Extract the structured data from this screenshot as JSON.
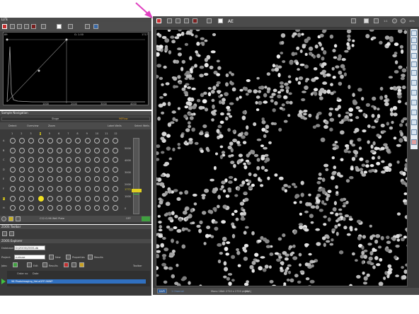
{
  "histogram": {
    "title": "LUTs",
    "max_label": "1717",
    "gamma_label": "G: 1.00",
    "min_label": "89",
    "ticks": [
      "1000",
      "2000",
      "3000",
      "4000"
    ]
  },
  "navigation": {
    "title": "Sample Navigation",
    "stage_label": "Stage",
    "grid_label": "96Flow",
    "tabs": [
      "Detect",
      "Overview",
      "Zoom"
    ],
    "label_wells": "Label Wells",
    "select_wells": "Select Wells",
    "columns": [
      "1",
      "2",
      "3",
      "4",
      "5",
      "6",
      "7",
      "8",
      "9",
      "10",
      "11",
      "12"
    ],
    "rows": [
      "A",
      "B",
      "C",
      "D",
      "E",
      "F",
      "G",
      "H"
    ],
    "selected_column": 4,
    "selected_row": 6,
    "depth_ticks": [
      "5000",
      "4000",
      "3000",
      "2000",
      "1000",
      "0"
    ],
    "depth_value": "1772",
    "plate_name": "C12-G-96 Well Plate",
    "status": "OFF"
  },
  "zoom_toolbar": {
    "title": "ZOOS Toolbar"
  },
  "explorer": {
    "title": "ZOOS Explorer",
    "database_label": "Database:",
    "database_value": "D:\\ZOOS\\ZOOS.db",
    "project_label": "Project:",
    "project_value": "z-nkuse",
    "new_label": "New",
    "properties_label": "Properties",
    "results_label": "Results",
    "jobs_label": "Jobs:",
    "edit_label": "Edit",
    "results_btn": "Results",
    "toolbar_label": "Toolbar",
    "order_label": "Order no",
    "date_label": "Date",
    "job_name": "96 PhotoImaging_HeLaGFP-96WP"
  },
  "viewer": {
    "toolbar_ae": "AE",
    "ratio_label": "1:1",
    "zoom_level": "40%",
    "status_tabs": [
      "DAPI",
      "1 Channel"
    ],
    "status_info": "Mono 16bit 2720 x 2720 pixels",
    "status_coords": "[N/A]"
  }
}
